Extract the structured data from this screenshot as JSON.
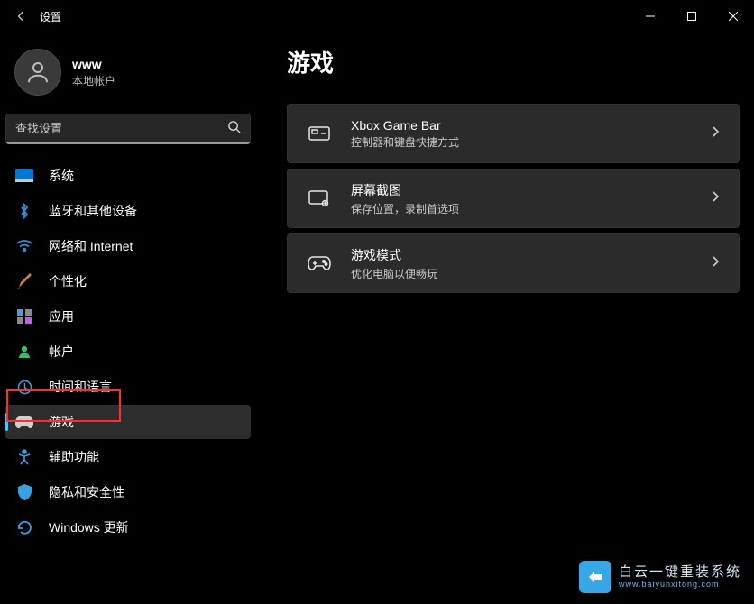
{
  "window": {
    "title": "设置"
  },
  "profile": {
    "name": "www",
    "subtitle": "本地帐户"
  },
  "search": {
    "placeholder": "查找设置"
  },
  "sidebar": {
    "items": [
      {
        "label": "系统"
      },
      {
        "label": "蓝牙和其他设备"
      },
      {
        "label": "网络和 Internet"
      },
      {
        "label": "个性化"
      },
      {
        "label": "应用"
      },
      {
        "label": "帐户"
      },
      {
        "label": "时间和语言"
      },
      {
        "label": "游戏"
      },
      {
        "label": "辅助功能"
      },
      {
        "label": "隐私和安全性"
      },
      {
        "label": "Windows 更新"
      }
    ]
  },
  "page": {
    "title": "游戏"
  },
  "cards": [
    {
      "title": "Xbox Game Bar",
      "subtitle": "控制器和键盘快捷方式"
    },
    {
      "title": "屏幕截图",
      "subtitle": "保存位置，录制首选项"
    },
    {
      "title": "游戏模式",
      "subtitle": "优化电脑以便畅玩"
    }
  ],
  "watermark": {
    "cn": "白云一键重装系统",
    "en": "www.baiyunxitong.com"
  }
}
